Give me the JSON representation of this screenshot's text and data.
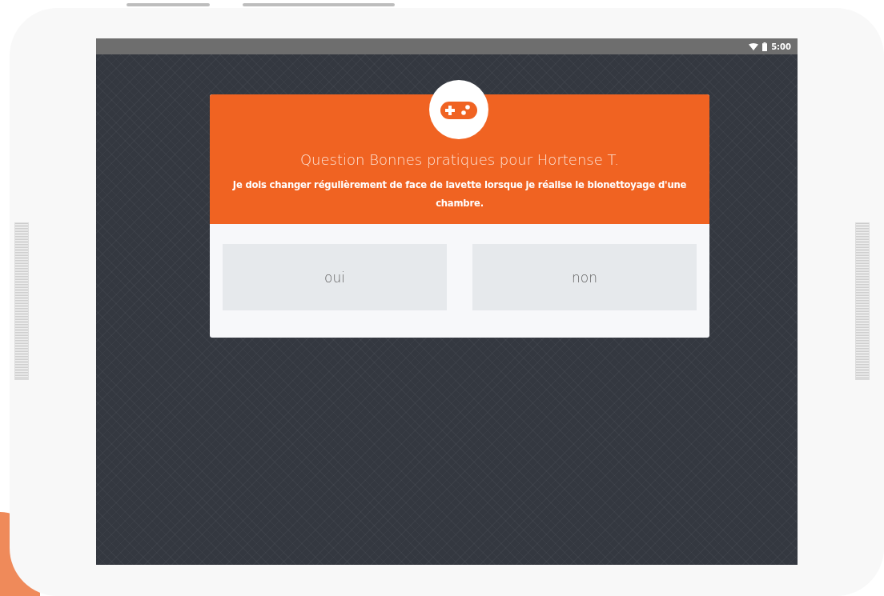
{
  "status_bar": {
    "time": "5:00"
  },
  "dialog": {
    "title": "Question Bonnes pratiques pour Hortense T.",
    "question": "Je dois changer régulièrement de face de lavette lorsque je réalise le bionettoyage d'une chambre.",
    "answers": [
      {
        "label": "oui"
      },
      {
        "label": "non"
      }
    ]
  }
}
